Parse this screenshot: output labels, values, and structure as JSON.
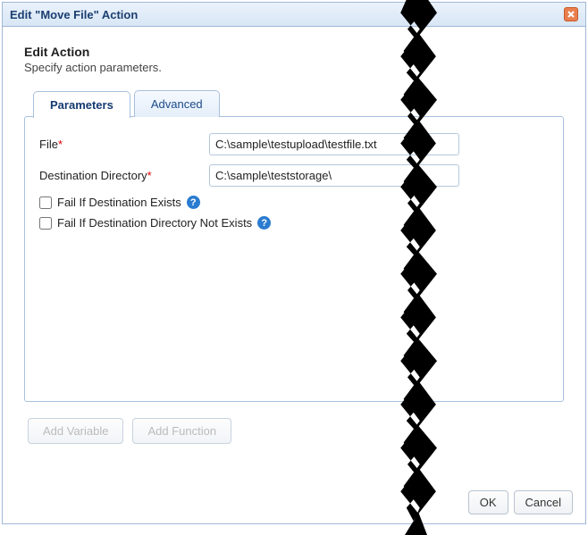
{
  "dialog": {
    "title": "Edit \"Move File\" Action"
  },
  "section": {
    "title": "Edit Action",
    "subtitle": "Specify action parameters."
  },
  "tabs": {
    "parameters": "Parameters",
    "advanced": "Advanced"
  },
  "fields": {
    "file_label": "File",
    "file_value": "C:\\sample\\testupload\\testfile.txt",
    "dest_label": "Destination Directory",
    "dest_value": "C:\\sample\\teststorage\\"
  },
  "checks": {
    "fail_exists": "Fail If Destination Exists",
    "fail_dir_not_exists": "Fail If Destination Directory Not Exists"
  },
  "buttons": {
    "add_variable": "Add Variable",
    "add_function": "Add Function",
    "ok": "OK",
    "cancel": "Cancel"
  },
  "required_marker": "*"
}
